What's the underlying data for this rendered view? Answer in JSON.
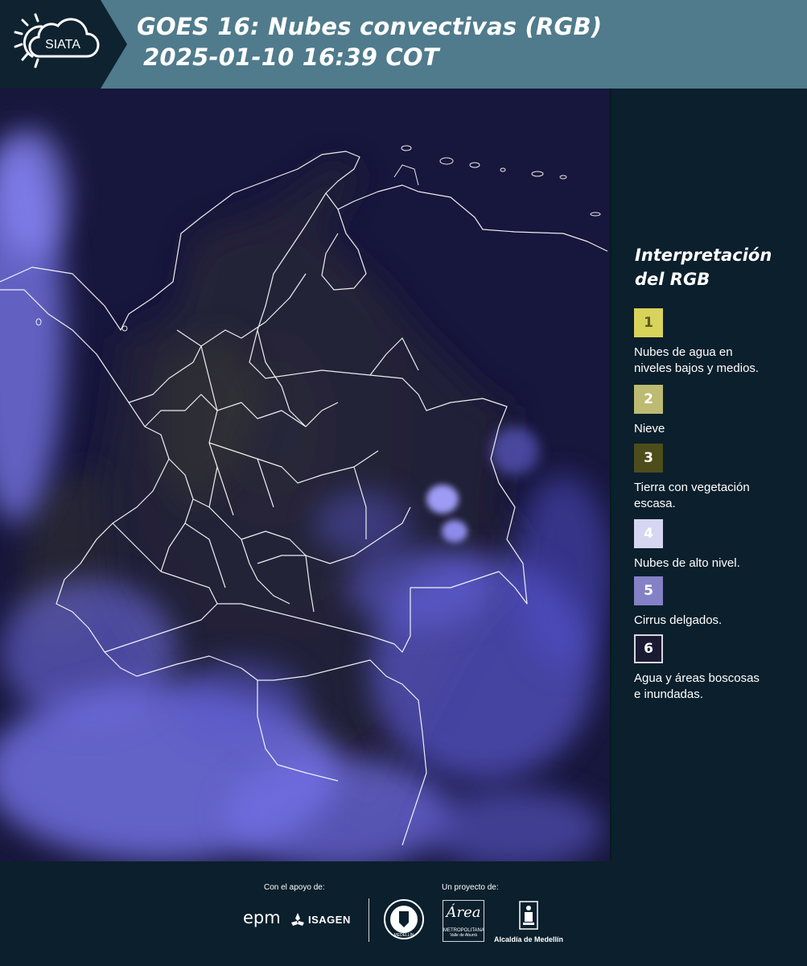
{
  "header": {
    "logo_text": "SIATA",
    "title_line1": "GOES 16: Nubes convectivas (RGB)",
    "title_line2": "2025-01-10 16:39 COT"
  },
  "legend": {
    "title_line1": "Interpretación",
    "title_line2": "del RGB",
    "items": [
      {
        "number": "1",
        "color": "#d8d35a",
        "text_color": "#5a5a20",
        "label_lines": [
          "Nubes de agua en",
          "niveles bajos y medios."
        ]
      },
      {
        "number": "2",
        "color": "#bdbb72",
        "text_color": "#ffffff",
        "label_lines": [
          "Nieve"
        ]
      },
      {
        "number": "3",
        "color": "#4d4d1c",
        "text_color": "#ffffff",
        "label_lines": [
          "Tierra con vegetación",
          "escasa."
        ]
      },
      {
        "number": "4",
        "color": "#d6d6f2",
        "text_color": "#ffffff",
        "label_lines": [
          "Nubes de alto nivel."
        ]
      },
      {
        "number": "5",
        "color": "#8481c6",
        "text_color": "#ffffff",
        "label_lines": [
          "Cirrus delgados."
        ]
      },
      {
        "number": "6",
        "color": "#1b1a33",
        "text_color": "#ffffff",
        "label_lines": [
          "Agua y áreas boscosas",
          "e inundadas."
        ]
      }
    ]
  },
  "footer": {
    "support_label": "Con el apoyo de:",
    "project_label": "Un proyecto de:",
    "sponsor_epm": "epm",
    "sponsor_isagen": "ISAGEN",
    "partner_medellin_seal": "MEDELLÍN",
    "partner_area_name": "Área",
    "partner_area_sub1": "METROPOLITANA",
    "partner_area_sub2": "Valle de Aburrá",
    "partner_alcaldia": "Alcaldía de Medellín"
  },
  "colors": {
    "header_bg": "#4f7b8c",
    "page_bg": "#0b1f2c",
    "map_base": "#18173e",
    "cloud": "#8a88ff",
    "border_lines": "#ffffff"
  }
}
